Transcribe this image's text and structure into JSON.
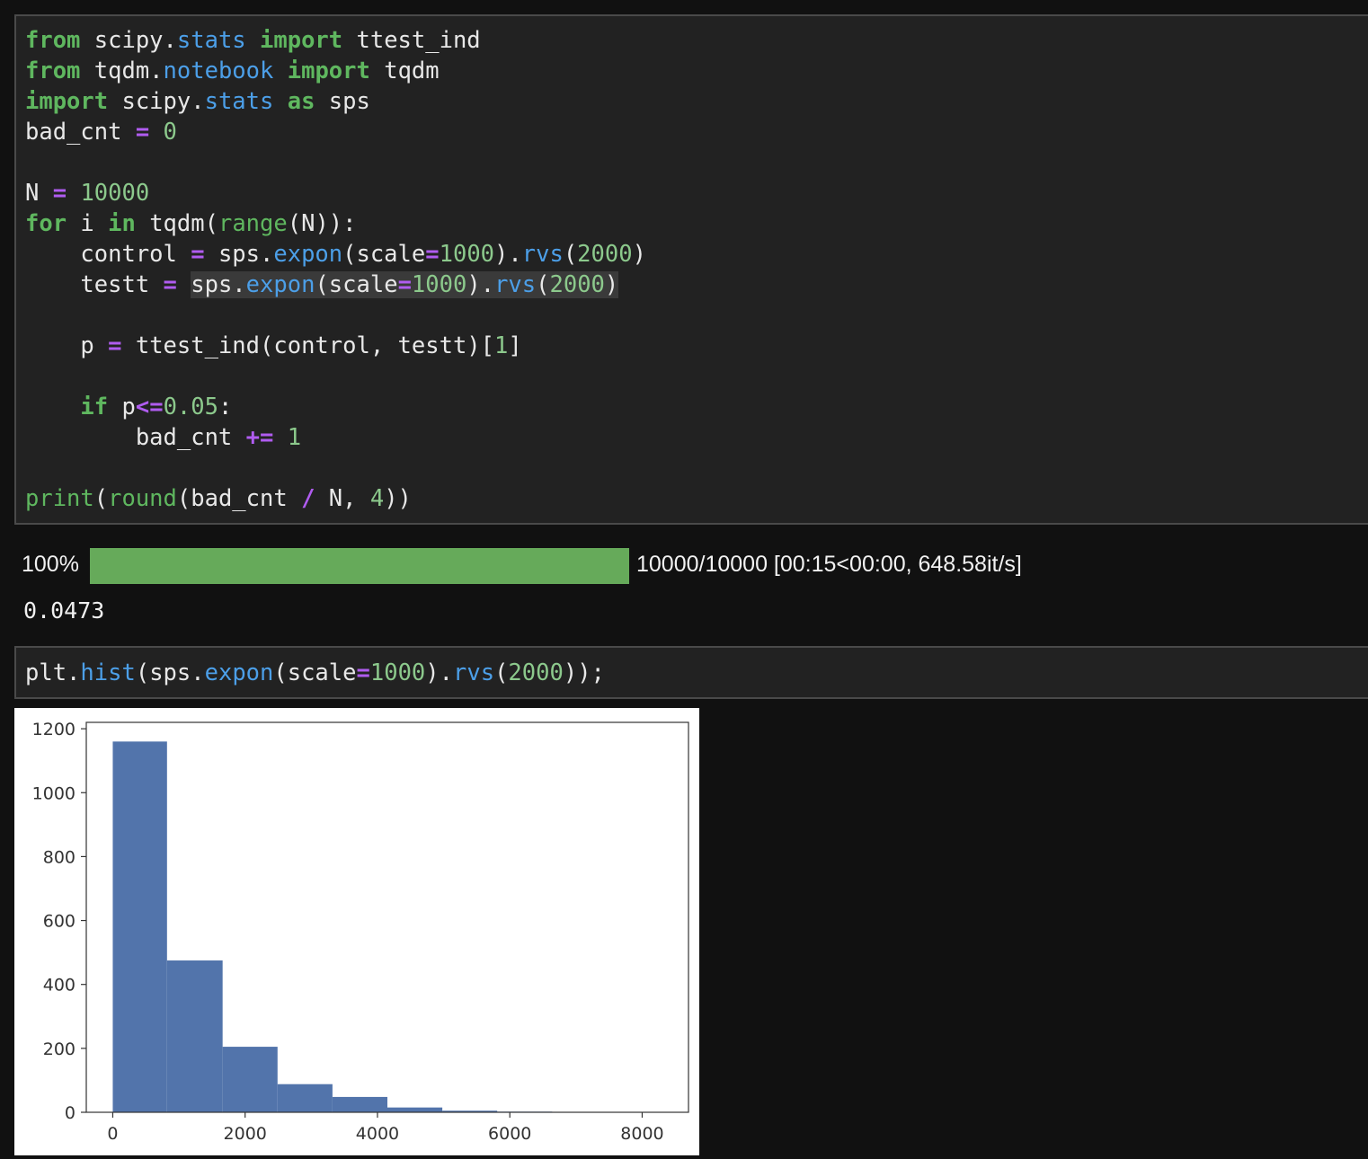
{
  "cell1": {
    "lines": [
      [
        {
          "c": "kw",
          "t": "from"
        },
        {
          "t": " scipy."
        },
        {
          "c": "attr",
          "t": "stats"
        },
        {
          "t": " "
        },
        {
          "c": "kw",
          "t": "import"
        },
        {
          "t": " ttest_ind"
        }
      ],
      [
        {
          "c": "kw",
          "t": "from"
        },
        {
          "t": " tqdm."
        },
        {
          "c": "attr",
          "t": "notebook"
        },
        {
          "t": " "
        },
        {
          "c": "kw",
          "t": "import"
        },
        {
          "t": " tqdm"
        }
      ],
      [
        {
          "c": "kw",
          "t": "import"
        },
        {
          "t": " scipy."
        },
        {
          "c": "attr",
          "t": "stats"
        },
        {
          "t": " "
        },
        {
          "c": "kw",
          "t": "as"
        },
        {
          "t": " sps"
        }
      ],
      [
        {
          "t": "bad_cnt "
        },
        {
          "c": "op",
          "t": "="
        },
        {
          "t": " "
        },
        {
          "c": "num",
          "t": "0"
        }
      ],
      [],
      [
        {
          "t": "N "
        },
        {
          "c": "op",
          "t": "="
        },
        {
          "t": " "
        },
        {
          "c": "num",
          "t": "10000"
        }
      ],
      [
        {
          "c": "kw",
          "t": "for"
        },
        {
          "t": " i "
        },
        {
          "c": "kw",
          "t": "in"
        },
        {
          "t": " tqdm("
        },
        {
          "c": "bi",
          "t": "range"
        },
        {
          "t": "(N)):"
        }
      ],
      [
        {
          "t": "    control "
        },
        {
          "c": "op",
          "t": "="
        },
        {
          "t": " sps."
        },
        {
          "c": "attr",
          "t": "expon"
        },
        {
          "t": "(scale"
        },
        {
          "c": "op",
          "t": "="
        },
        {
          "c": "num",
          "t": "1000"
        },
        {
          "t": ")."
        },
        {
          "c": "attr",
          "t": "rvs"
        },
        {
          "t": "("
        },
        {
          "c": "num",
          "t": "2000"
        },
        {
          "t": ")"
        }
      ],
      [
        {
          "t": "    testt "
        },
        {
          "c": "op",
          "t": "="
        },
        {
          "t": " "
        },
        {
          "c": "hl",
          "t": "sps."
        },
        {
          "c": "attr hl",
          "t": "expon"
        },
        {
          "c": "hl",
          "t": "(scale"
        },
        {
          "c": "op hl",
          "t": "="
        },
        {
          "c": "num hl",
          "t": "1000"
        },
        {
          "c": "hl",
          "t": ")."
        },
        {
          "c": "attr hl",
          "t": "rvs"
        },
        {
          "c": "hl",
          "t": "("
        },
        {
          "c": "num hl",
          "t": "2000"
        },
        {
          "c": "hl",
          "t": ")"
        }
      ],
      [],
      [
        {
          "t": "    p "
        },
        {
          "c": "op",
          "t": "="
        },
        {
          "t": " ttest_ind(control, testt)["
        },
        {
          "c": "num",
          "t": "1"
        },
        {
          "t": "]"
        }
      ],
      [],
      [
        {
          "t": "    "
        },
        {
          "c": "kw",
          "t": "if"
        },
        {
          "t": " p"
        },
        {
          "c": "op",
          "t": "<="
        },
        {
          "c": "num",
          "t": "0.05"
        },
        {
          "t": ":"
        }
      ],
      [
        {
          "t": "        bad_cnt "
        },
        {
          "c": "op",
          "t": "+="
        },
        {
          "t": " "
        },
        {
          "c": "num",
          "t": "1"
        }
      ],
      [],
      [
        {
          "c": "bi",
          "t": "print"
        },
        {
          "t": "("
        },
        {
          "c": "bi",
          "t": "round"
        },
        {
          "t": "(bad_cnt "
        },
        {
          "c": "op",
          "t": "/"
        },
        {
          "t": " N, "
        },
        {
          "c": "num",
          "t": "4"
        },
        {
          "t": "))"
        }
      ]
    ]
  },
  "progress": {
    "percent_label": "100%",
    "fraction": 1.0,
    "stats": "10000/10000 [00:15<00:00, 648.58it/s]"
  },
  "output1": {
    "text": "0.0473"
  },
  "cell2": {
    "lines": [
      [
        {
          "t": "plt."
        },
        {
          "c": "attr",
          "t": "hist"
        },
        {
          "t": "(sps."
        },
        {
          "c": "attr",
          "t": "expon"
        },
        {
          "t": "(scale"
        },
        {
          "c": "op",
          "t": "="
        },
        {
          "c": "num",
          "t": "1000"
        },
        {
          "t": ")."
        },
        {
          "c": "attr",
          "t": "rvs"
        },
        {
          "t": "("
        },
        {
          "c": "num",
          "t": "2000"
        },
        {
          "t": "));"
        }
      ]
    ]
  },
  "colors": {
    "bar": "#5274ab",
    "progress_fill": "#66aa5a"
  },
  "chart_data": {
    "type": "bar",
    "title": "",
    "xlabel": "",
    "ylabel": "",
    "bins": [
      {
        "x0": 0,
        "x1": 820,
        "count": 1160
      },
      {
        "x0": 820,
        "x1": 1660,
        "count": 475
      },
      {
        "x0": 1660,
        "x1": 2490,
        "count": 205
      },
      {
        "x0": 2490,
        "x1": 3320,
        "count": 88
      },
      {
        "x0": 3320,
        "x1": 4150,
        "count": 48
      },
      {
        "x0": 4150,
        "x1": 4980,
        "count": 15
      },
      {
        "x0": 4980,
        "x1": 5810,
        "count": 5
      },
      {
        "x0": 5810,
        "x1": 6640,
        "count": 2
      },
      {
        "x0": 6640,
        "x1": 7470,
        "count": 1
      },
      {
        "x0": 7470,
        "x1": 8300,
        "count": 1
      }
    ],
    "xlim": [
      -400,
      8700
    ],
    "ylim": [
      0,
      1220
    ],
    "xticks": [
      0,
      2000,
      4000,
      6000,
      8000
    ],
    "yticks": [
      0,
      200,
      400,
      600,
      800,
      1000,
      1200
    ],
    "grid": false
  }
}
